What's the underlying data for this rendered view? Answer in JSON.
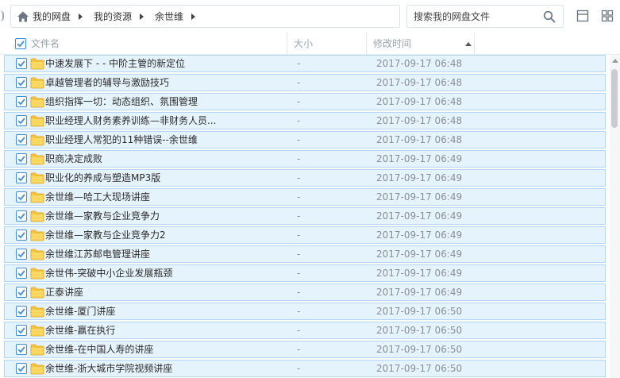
{
  "breadcrumb": {
    "items": [
      {
        "label": "我的网盘"
      },
      {
        "label": "我的资源"
      },
      {
        "label": "余世维"
      }
    ]
  },
  "search": {
    "placeholder": "搜索我的网盘文件"
  },
  "columns": {
    "name": "文件名",
    "size": "大小",
    "modified": "修改时间"
  },
  "files": [
    {
      "name": "中速发展下 - - 中阶主管的新定位",
      "size": "-",
      "modified": "2017-09-17 06:48"
    },
    {
      "name": "卓越管理者的辅导与激励技巧",
      "size": "-",
      "modified": "2017-09-17 06:48"
    },
    {
      "name": "组织指挥一切：动态组织、氛围管理",
      "size": "-",
      "modified": "2017-09-17 06:48"
    },
    {
      "name": "职业经理人财务素养训练—非财务人员...",
      "size": "-",
      "modified": "2017-09-17 06:48"
    },
    {
      "name": "职业经理人常犯的11种错误--余世维",
      "size": "-",
      "modified": "2017-09-17 06:48"
    },
    {
      "name": "职商决定成败",
      "size": "-",
      "modified": "2017-09-17 06:49"
    },
    {
      "name": "职业化的养成与塑造MP3版",
      "size": "-",
      "modified": "2017-09-17 06:49"
    },
    {
      "name": "余世维—哈工大现场讲座",
      "size": "-",
      "modified": "2017-09-17 06:49"
    },
    {
      "name": "余世维—家教与企业竞争力",
      "size": "-",
      "modified": "2017-09-17 06:49"
    },
    {
      "name": "余世维—家教与企业竞争力2",
      "size": "-",
      "modified": "2017-09-17 06:49"
    },
    {
      "name": "余世维江苏邮电管理讲座",
      "size": "-",
      "modified": "2017-09-17 06:49"
    },
    {
      "name": "余世伟-突破中小企业发展瓶颈",
      "size": "-",
      "modified": "2017-09-17 06:49"
    },
    {
      "name": "正泰讲座",
      "size": "-",
      "modified": "2017-09-17 06:49"
    },
    {
      "name": "余世维-厦门讲座",
      "size": "-",
      "modified": "2017-09-17 06:50"
    },
    {
      "name": "余世维-赢在执行",
      "size": "-",
      "modified": "2017-09-17 06:50"
    },
    {
      "name": "余世维-在中国人寿的讲座",
      "size": "-",
      "modified": "2017-09-17 06:50"
    },
    {
      "name": "余世维-浙大城市学院视频讲座",
      "size": "-",
      "modified": "2017-09-17 06:50"
    }
  ]
}
